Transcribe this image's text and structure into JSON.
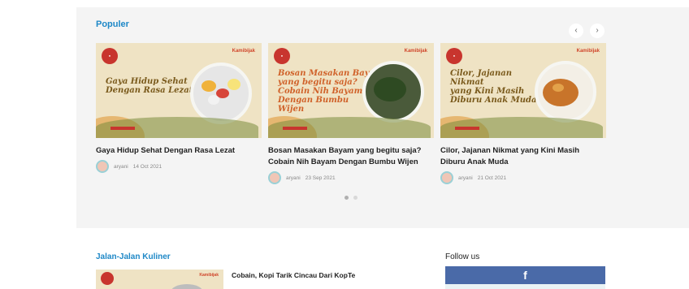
{
  "populer": {
    "title": "Populer",
    "prev_icon": "‹",
    "next_icon": "›",
    "cards": [
      {
        "headline": "Gaya Hidup Sehat\nDengan Rasa Lezat",
        "brand": "Kamibijak",
        "title": "Gaya Hidup Sehat Dengan Rasa Lezat",
        "author": "aryani",
        "date": "14 Oct 2021"
      },
      {
        "headline": "Bosan Masakan Bayam\nyang begitu saja?\nCobain Nih Bayam\nDengan Bumbu\nWijen",
        "brand": "Kamibijak",
        "title": "Bosan Masakan Bayam yang begitu saja? Cobain Nih Bayam Dengan Bumbu Wijen",
        "author": "aryani",
        "date": "23 Sep 2021"
      },
      {
        "headline": "Cilor, Jajanan\nNikmat\nyang Kini Masih\nDiburu Anak Muda",
        "brand": "Kamibijak",
        "title": "Cilor, Jajanan Nikmat yang Kini Masih Diburu Anak Muda",
        "author": "aryani",
        "date": "21 Oct 2021"
      }
    ],
    "pagination": {
      "total": 2,
      "active": 1
    }
  },
  "kuliner": {
    "title": "Jalan-Jalan Kuliner",
    "brand": "Kamibijak",
    "first_title": "Cobain, Kopi Tarik Cincau Dari KopTe"
  },
  "follow": {
    "title": "Follow us",
    "facebook_glyph": "f"
  },
  "colors": {
    "accent": "#1e88c7",
    "section_bg": "#f4f4f4",
    "facebook": "#4a6aa8",
    "brand_red": "#c8352e"
  }
}
